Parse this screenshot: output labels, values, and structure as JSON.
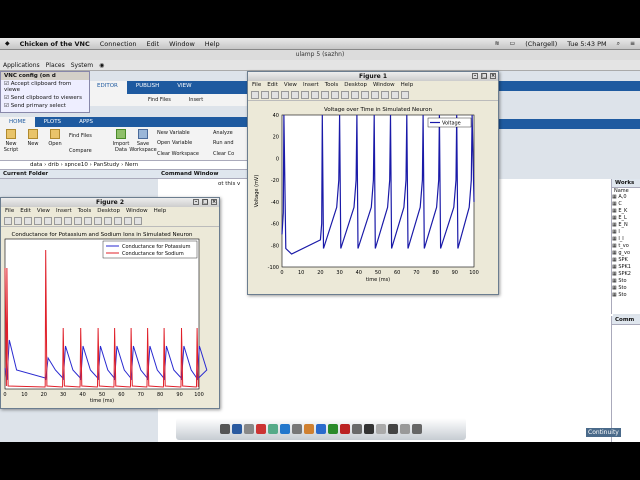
{
  "mac_menubar": {
    "app": "Chicken of the VNC",
    "items": [
      "Connection",
      "Edit",
      "Window",
      "Help"
    ],
    "user": "(Chargell)",
    "clock": "Tue 5:43 PM"
  },
  "remote_title": "ulamp 5 (sazhn)",
  "gnome_panel": {
    "items": [
      "Applications",
      "Places",
      "System"
    ]
  },
  "vnc_config": {
    "title": "VNC config (on d",
    "options": [
      "Accept clipboard from viewe",
      "Send clipboard to viewers",
      "Send primary select"
    ]
  },
  "matlab": {
    "tabs": [
      "HOME",
      "PLOTS",
      "APPS"
    ],
    "editor_tabs": [
      "EDITOR",
      "PUBLISH",
      "VIEW"
    ],
    "ribbon_buttons": [
      "New Script",
      "New",
      "Open",
      "Find Files",
      "Compare",
      "Import Data",
      "Save Workspace"
    ],
    "ribbon_small": [
      "New Variable",
      "Open Variable",
      "Clear Workspace",
      "Analyze",
      "Run and",
      "Clear Co"
    ],
    "editor_find": "Find Files",
    "editor_insert": "Insert",
    "path": [
      "data",
      "drib",
      "spnce10",
      "PanStudy",
      "Nern"
    ],
    "current_folder": "Current Folder",
    "command_window": "Command Window",
    "command_snip": "ot this v",
    "workspace": "Works",
    "workspace_name": "Name",
    "workspace_items": [
      "A,0",
      "C",
      "E_K",
      "E_L",
      "E_N",
      "I",
      "I_I",
      "t_vo",
      "g_vo",
      "SPK",
      "SPK1",
      "SPK2",
      "Sto",
      "Sto",
      "Sto"
    ],
    "command_history": "Comm"
  },
  "figure1": {
    "title": "Figure 1",
    "menu": [
      "File",
      "Edit",
      "View",
      "Insert",
      "Tools",
      "Desktop",
      "Window",
      "Help"
    ],
    "chart_data": {
      "type": "line",
      "title": "Voltage over Time in Simulated Neuron",
      "xlabel": "time (ms)",
      "ylabel": "Voltage (mV)",
      "xlim": [
        0,
        100
      ],
      "ylim": [
        -100,
        40
      ],
      "xticks": [
        0,
        10,
        20,
        30,
        40,
        50,
        60,
        70,
        80,
        90,
        100
      ],
      "yticks": [
        40,
        20,
        0,
        -20,
        -40,
        -60,
        -80,
        -100
      ],
      "legend": "Voltage",
      "legend_pos": "top-right",
      "colors": {
        "voltage": "#1a1aa8"
      },
      "spike_times": [
        1,
        21,
        30,
        39,
        48,
        56.5,
        65,
        73.5,
        82,
        91,
        99
      ],
      "series": [
        {
          "name": "Voltage",
          "peak": 40,
          "trough": -83
        }
      ]
    }
  },
  "figure2": {
    "title": "Figure 2",
    "menu": [
      "File",
      "Edit",
      "View",
      "Insert",
      "Tools",
      "Desktop",
      "Window",
      "Help"
    ],
    "chart_data": {
      "type": "line",
      "title": "Conductance for Potassium and Sodium Ions in Simulated Neuron",
      "xlabel": "time (ms)",
      "xlim": [
        0,
        100
      ],
      "xticks": [
        0,
        10,
        20,
        30,
        40,
        50,
        60,
        70,
        80,
        90,
        100
      ],
      "series": [
        {
          "name": "Conductance for Potassium",
          "color": "#2a2ad0"
        },
        {
          "name": "Conductance for Sodium",
          "color": "#e0202a"
        }
      ],
      "legend_pos": "top-right",
      "spike_times": [
        1,
        21,
        30,
        39,
        48,
        56.5,
        65,
        73.5,
        82,
        91,
        99
      ]
    }
  },
  "dock": {
    "label": "Continuity"
  }
}
